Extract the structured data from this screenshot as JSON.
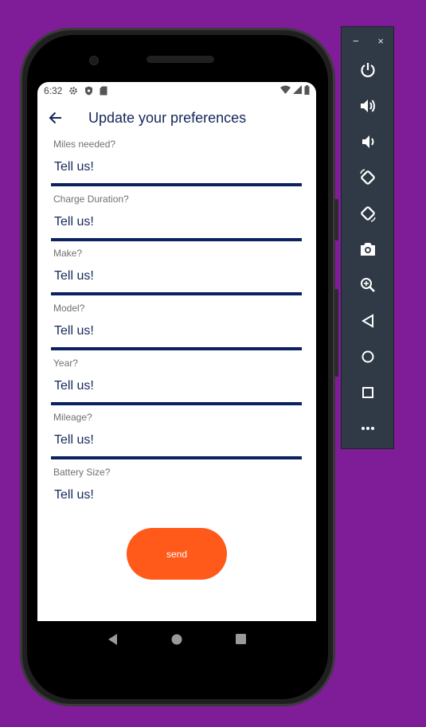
{
  "status": {
    "time": "6:32"
  },
  "appbar": {
    "title": "Update your preferences"
  },
  "fields": [
    {
      "label": "Miles needed?",
      "value": "Tell us!"
    },
    {
      "label": "Charge Duration?",
      "value": "Tell us!"
    },
    {
      "label": "Make?",
      "value": "Tell us!"
    },
    {
      "label": "Model?",
      "value": "Tell us!"
    },
    {
      "label": "Year?",
      "value": "Tell us!"
    },
    {
      "label": "Mileage?",
      "value": "Tell us!"
    },
    {
      "label": "Battery Size?",
      "value": "Tell us!"
    }
  ],
  "send_label": "send",
  "toolbar": {
    "minimize": "−",
    "close": "×",
    "buttons": [
      "power-icon",
      "volume-up-icon",
      "volume-down-icon",
      "rotate-left-icon",
      "rotate-right-icon",
      "camera-icon",
      "zoom-icon",
      "back-icon",
      "home-icon",
      "overview-icon",
      "more-icon"
    ]
  },
  "colors": {
    "background": "#7f1c97",
    "accent": "#ff5a1a",
    "primary": "#14285a",
    "toolbar": "#2f3a46"
  }
}
